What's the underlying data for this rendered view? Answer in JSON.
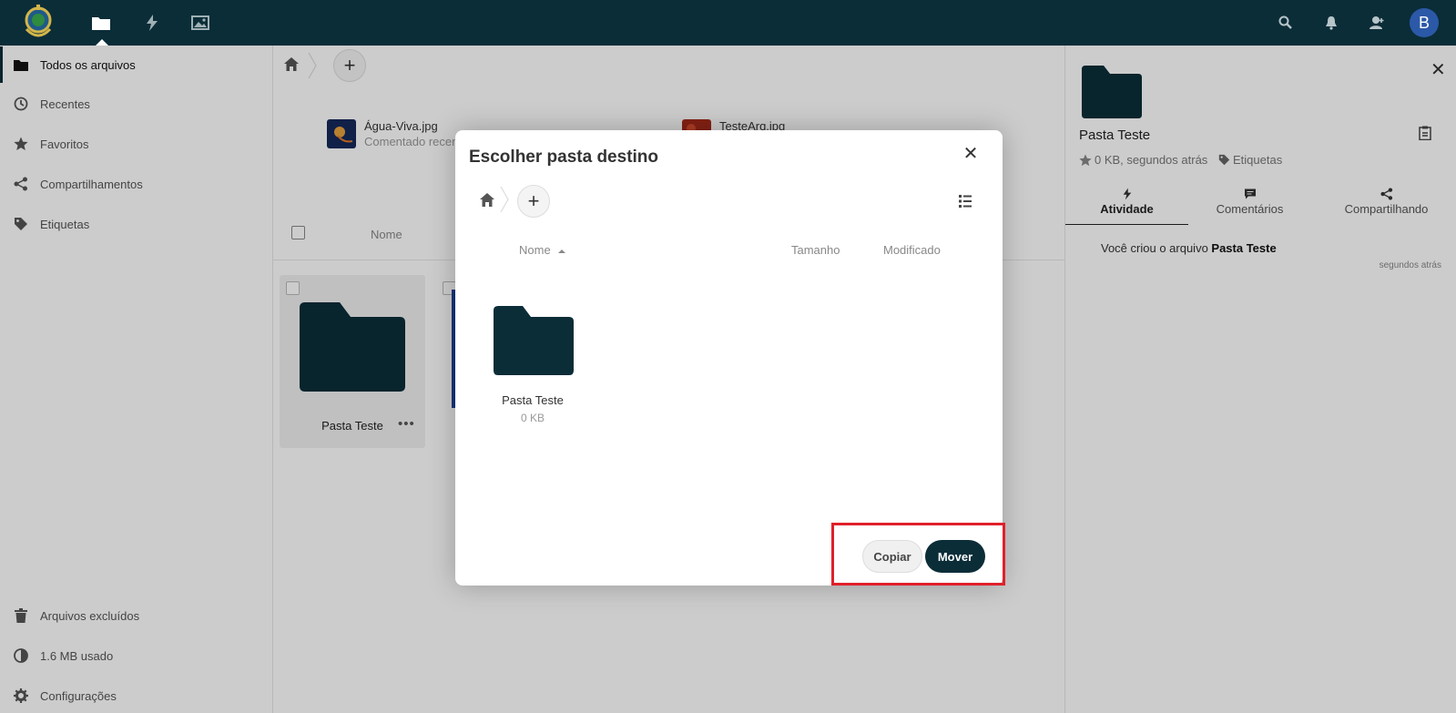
{
  "colors": {
    "primary": "#0b2d38",
    "highlight": "#e0202a",
    "avatar": "#2b59a8"
  },
  "topbar": {
    "icons": [
      "files-icon",
      "activity-icon",
      "gallery-icon",
      "search-icon",
      "bell-icon",
      "contacts-icon"
    ],
    "avatar_letter": "B"
  },
  "sidebar": {
    "items": [
      {
        "label": "Todos os arquivos",
        "icon": "folder-icon"
      },
      {
        "label": "Recentes",
        "icon": "clock-icon"
      },
      {
        "label": "Favoritos",
        "icon": "star-icon"
      },
      {
        "label": "Compartilhamentos",
        "icon": "share-icon"
      },
      {
        "label": "Etiquetas",
        "icon": "tag-icon"
      }
    ],
    "bottom": [
      {
        "label": "Arquivos excluídos",
        "icon": "trash-icon"
      },
      {
        "label": "1.6 MB usado",
        "icon": "quota-icon"
      },
      {
        "label": "Configurações",
        "icon": "gear-icon"
      }
    ]
  },
  "main": {
    "recent": [
      {
        "name": "Água-Viva.jpg",
        "sub": "Comentado recen"
      },
      {
        "name": "TesteArq.jpg",
        "sub": ""
      }
    ],
    "list_header": {
      "name": "Nome"
    },
    "tile": {
      "name": "Pasta Teste"
    }
  },
  "modal": {
    "title": "Escolher pasta destino",
    "columns": {
      "name": "Nome",
      "size": "Tamanho",
      "modified": "Modificado"
    },
    "folder": {
      "name": "Pasta Teste",
      "size": "0 KB"
    },
    "buttons": {
      "copy": "Copiar",
      "move": "Mover"
    }
  },
  "rpanel": {
    "title": "Pasta Teste",
    "meta": "0 KB, segundos atrás",
    "tags": "Etiquetas",
    "tabs": [
      "Atividade",
      "Comentários",
      "Compartilhando"
    ],
    "activity_prefix": "Você criou o arquivo ",
    "activity_target": "Pasta Teste",
    "activity_time": "segundos atrás"
  }
}
